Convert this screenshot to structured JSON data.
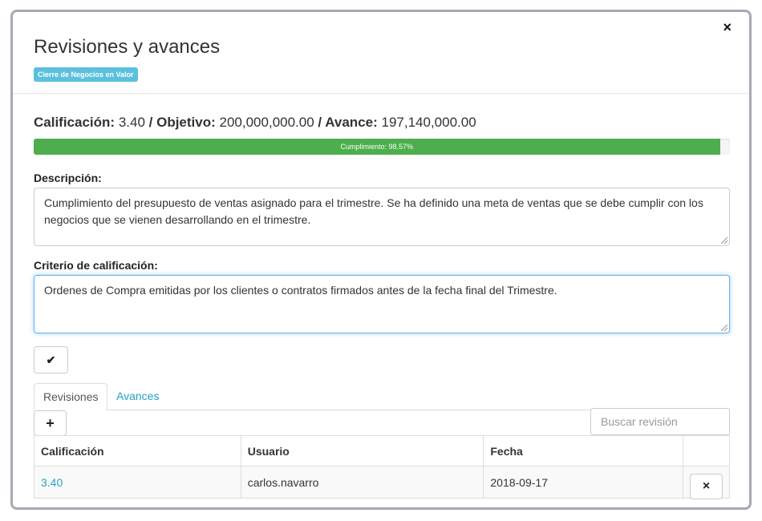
{
  "modal": {
    "title": "Revisiones y avances",
    "badge": "Cierre de Negocios en Valor",
    "close_icon": "×"
  },
  "summary": {
    "calificacion_label": "Calificación:",
    "calificacion_value": "3.40",
    "objetivo_label": "/ Objetivo:",
    "objetivo_value": "200,000,000.00",
    "avance_label": "/ Avance:",
    "avance_value": "197,140,000.00"
  },
  "progress": {
    "label": "Cumplimiento: 98.57%",
    "percent": 98.57,
    "color": "#4cae4c"
  },
  "descripcion": {
    "label": "Descripción:",
    "value": "Cumplimiento del presupuesto de ventas asignado para el trimestre. Se ha definido una meta de ventas que se debe cumplir con los negocios que se vienen desarrollando en el trimestre."
  },
  "criterio": {
    "label": "Criterio de calificación:",
    "value": "Ordenes de Compra emitidas por los clientes o contratos firmados antes de la fecha final del Trimestre."
  },
  "buttons": {
    "save_icon": "✔",
    "add_icon": "+",
    "delete_icon": "×"
  },
  "tabs": [
    {
      "label": "Revisiones",
      "active": true
    },
    {
      "label": "Avances",
      "active": false
    }
  ],
  "search": {
    "placeholder": "Buscar revisión"
  },
  "table": {
    "headers": [
      "Calificación",
      "Usuario",
      "Fecha",
      ""
    ],
    "rows": [
      {
        "calificacion": "3.40",
        "usuario": "carlos.navarro",
        "fecha": "2018-09-17"
      }
    ]
  },
  "colors": {
    "badge": "#5bc0de",
    "link": "#23a0c8",
    "focus_border": "#66afe9"
  }
}
